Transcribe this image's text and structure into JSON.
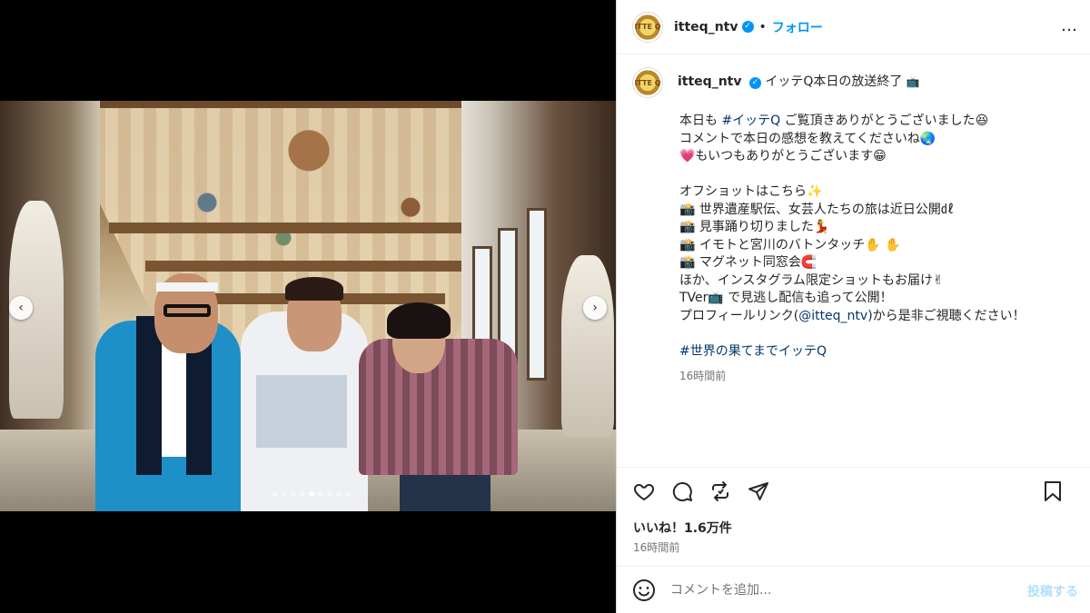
{
  "post": {
    "username": "itteq_ntv",
    "verified_mark": "✓",
    "bullet": "•",
    "follow_label": "フォロー",
    "more_icon": "…",
    "avatar_text": "ITTE Q",
    "caption_title": "イッテQ本日の放送終了",
    "caption_title_emoji": "📺",
    "lines": [
      {
        "pre": "本日も ",
        "tag": "#イッテQ",
        "post": " ご覧頂きありがとうございました😆"
      },
      {
        "text": "コメントで本日の感想を教えてくださいね🌏"
      },
      {
        "text": "💗もいつもありがとうございます😁"
      },
      {
        "blank": true
      },
      {
        "text": "オフショットはこちら✨"
      },
      {
        "text": "📸 世界遺産駅伝、女芸人たちの旅は近日公開㎗"
      },
      {
        "text": "📸 見事踊り切りました💃"
      },
      {
        "text": "📸 イモトと宮川のバトンタッチ✋ ✋"
      },
      {
        "text": "📸 マグネット同窓会🧲"
      },
      {
        "text": "ほか、インスタグラム限定ショットもお届け✌"
      },
      {
        "text": "TVer📺 で見逃し配信も追って公開！"
      },
      {
        "pre": "プロフィールリンク(",
        "tag": "@itteq_ntv",
        "post": ")から是非ご視聴ください！"
      },
      {
        "blank": true
      },
      {
        "tag_only": "#世界の果てまでイッテQ"
      }
    ],
    "caption_time": "16時間前",
    "likes": "いいね！1.6万件",
    "timestamp": "16時間前",
    "comment_placeholder": "コメントを追加...",
    "post_button": "投稿する"
  },
  "carousel": {
    "prev_icon": "‹",
    "next_icon": "›",
    "slide_count": 9,
    "active_index": 4
  },
  "icons": {
    "like": "heart-icon",
    "comment": "comment-icon",
    "share": "repost-icon",
    "send": "send-icon",
    "save": "bookmark-icon",
    "emoji": "emoji-icon"
  },
  "colors": {
    "link_blue": "#0095f6",
    "hashtag": "#00376b",
    "muted": "#737373"
  }
}
